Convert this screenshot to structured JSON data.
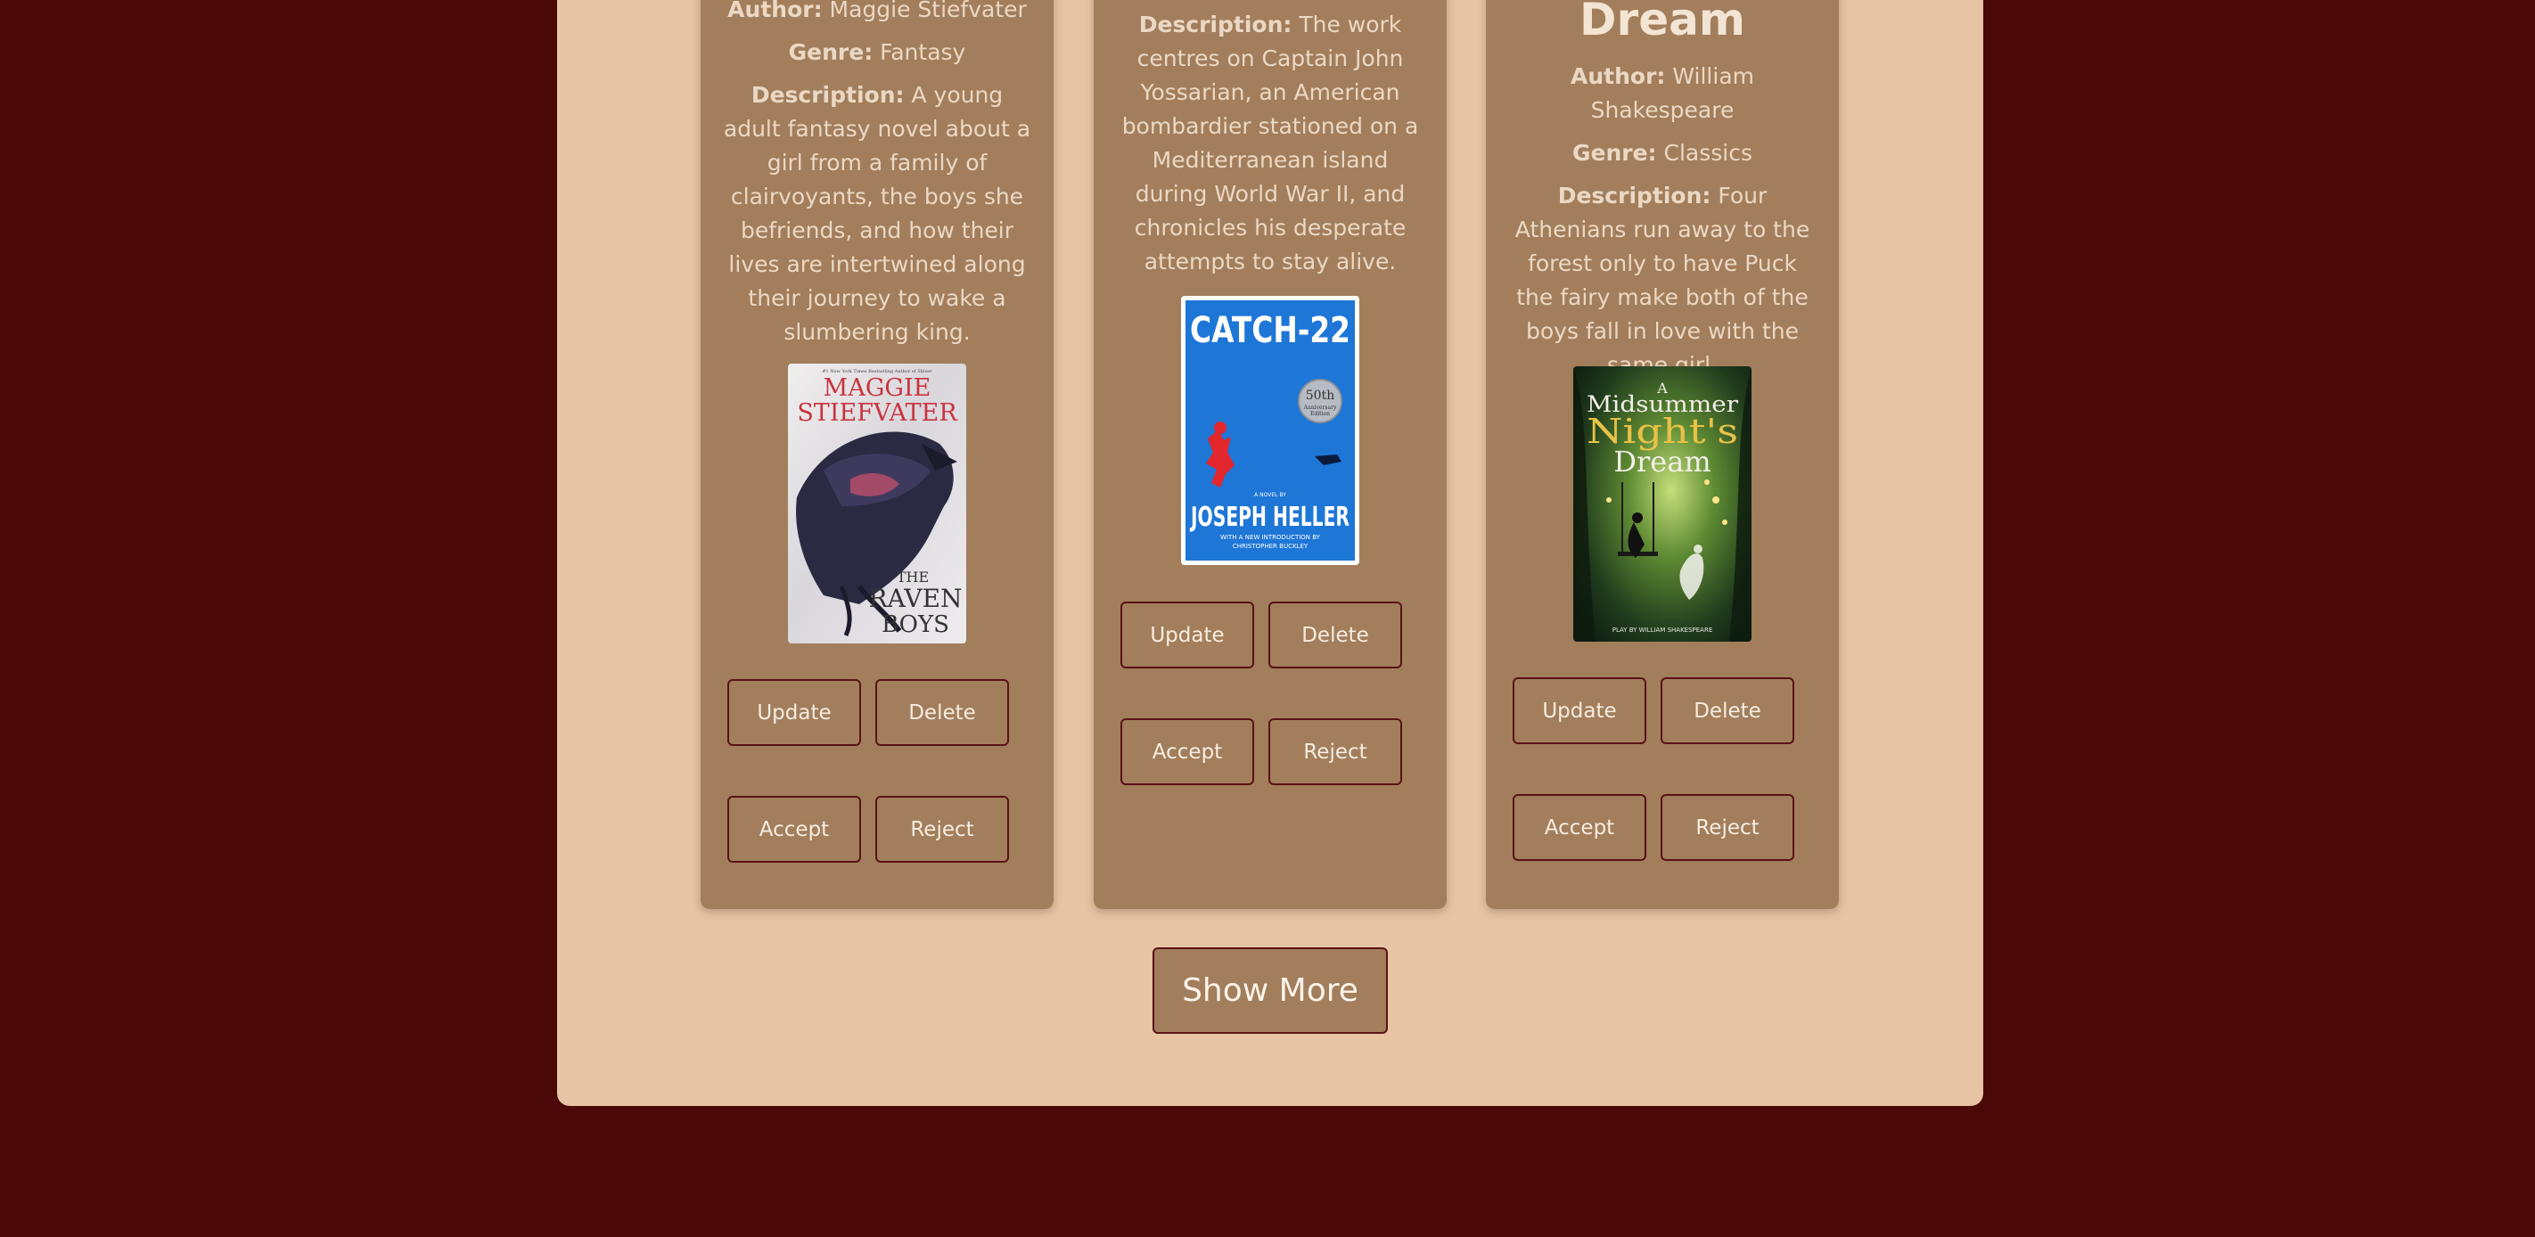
{
  "books": [
    {
      "title": "",
      "author_label": "Author:",
      "author": "Maggie Stiefvater",
      "genre_label": "Genre:",
      "genre": "Fantasy",
      "description_label": "Description:",
      "description": "A young adult fantasy novel about a girl from a family of clairvoyants, the boys she befriends, and how their lives are intertwined along their journey to wake a slumbering king.",
      "cover": {
        "top_text": "#1 New York Times Bestselling Author of Shiver",
        "author_text": "MAGGIE STIEFVATER",
        "title_line1": "THE",
        "title_line2": "RAVEN",
        "title_line3": "BOYS"
      },
      "update_label": "Update",
      "delete_label": "Delete",
      "accept_label": "Accept",
      "reject_label": "Reject"
    },
    {
      "title": "",
      "description_label": "Description:",
      "description": "The work centres on Captain John Yossarian, an American bombardier stationed on a Mediterranean island during World War II, and chronicles his desperate attempts to stay alive.",
      "cover": {
        "title_text": "CATCH-22",
        "badge_number": "50th",
        "badge_line1": "Anniversary",
        "badge_line2": "Edition",
        "byline": "A NOVEL BY",
        "author_text": "JOSEPH HELLER",
        "intro_line1": "WITH A NEW INTRODUCTION BY",
        "intro_line2": "CHRISTOPHER BUCKLEY"
      },
      "update_label": "Update",
      "delete_label": "Delete",
      "accept_label": "Accept",
      "reject_label": "Reject"
    },
    {
      "title": "Dream",
      "author_label": "Author:",
      "author": "William Shakespeare",
      "genre_label": "Genre:",
      "genre": "Classics",
      "description_label": "Description:",
      "description": "Four Athenians run away to the forest only to have Puck the fairy make both of the boys fall in love with the same girl.",
      "cover": {
        "line1": "A",
        "line2": "Midsummer",
        "line3": "Night's",
        "line4": "Dream",
        "footer": "PLAY BY WILLIAM SHAKESPEARE"
      },
      "update_label": "Update",
      "delete_label": "Delete",
      "accept_label": "Accept",
      "reject_label": "Reject"
    }
  ],
  "show_more_label": "Show More",
  "colors": {
    "background": "#4a0809",
    "panel": "#e6c4a4",
    "card": "#a27e5c",
    "button_border": "#5a1216"
  }
}
